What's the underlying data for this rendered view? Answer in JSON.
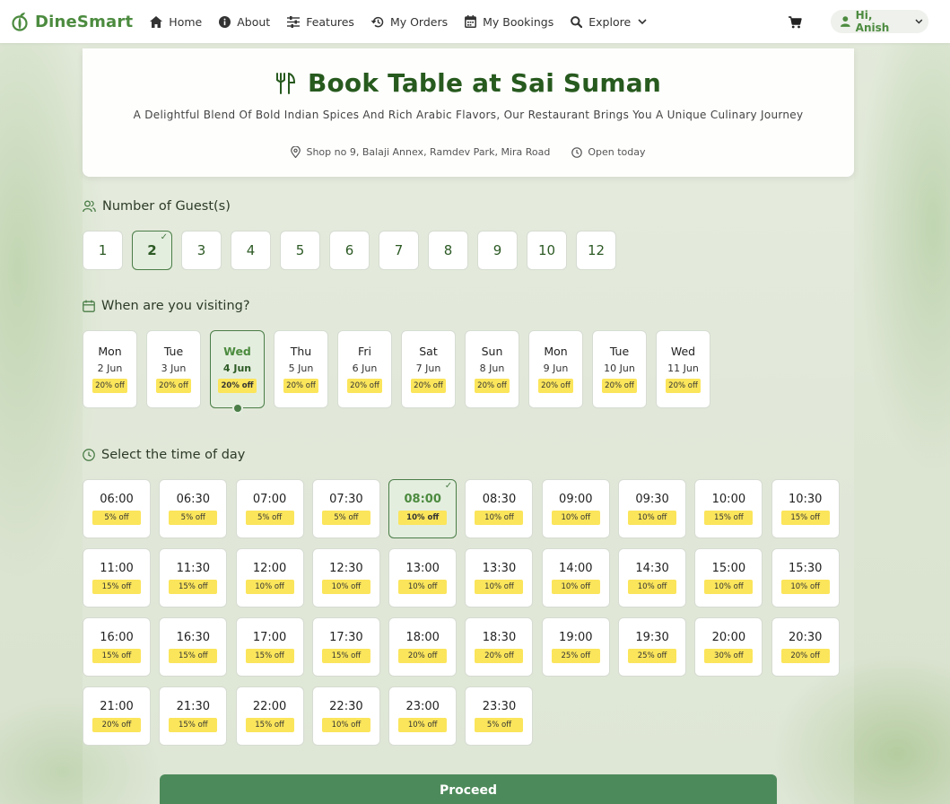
{
  "brand": {
    "name": "DineSmart"
  },
  "nav": {
    "items": [
      {
        "label": "Home",
        "icon": "home-icon"
      },
      {
        "label": "About",
        "icon": "info-icon"
      },
      {
        "label": "Features",
        "icon": "sliders-icon"
      },
      {
        "label": "My Orders",
        "icon": "history-icon"
      },
      {
        "label": "My Bookings",
        "icon": "calendar-icon"
      },
      {
        "label": "Explore",
        "icon": "search-icon"
      }
    ],
    "cart_icon": "cart-icon",
    "user_greeting": "Hi, Anish"
  },
  "header": {
    "title": "Book Table at Sai Suman",
    "subtitle": "A Delightful Blend Of Bold Indian Spices And Rich Arabic Flavors, Our Restaurant Brings You A Unique Culinary Journey",
    "address": "Shop no 9, Balaji Annex, Ramdev Park, Mira Road",
    "status": "Open today"
  },
  "guests": {
    "title": "Number of Guest(s)",
    "options": [
      "1",
      "2",
      "3",
      "4",
      "5",
      "6",
      "7",
      "8",
      "9",
      "10",
      "12"
    ],
    "selected": "2",
    "check_mark": "✓"
  },
  "visit": {
    "title": "When are you visiting?",
    "dates": [
      {
        "day": "Mon",
        "date": "2 Jun",
        "discount": "20% off"
      },
      {
        "day": "Tue",
        "date": "3 Jun",
        "discount": "20% off"
      },
      {
        "day": "Wed",
        "date": "4 Jun",
        "discount": "20% off"
      },
      {
        "day": "Thu",
        "date": "5 Jun",
        "discount": "20% off"
      },
      {
        "day": "Fri",
        "date": "6 Jun",
        "discount": "20% off"
      },
      {
        "day": "Sat",
        "date": "7 Jun",
        "discount": "20% off"
      },
      {
        "day": "Sun",
        "date": "8 Jun",
        "discount": "20% off"
      },
      {
        "day": "Mon",
        "date": "9 Jun",
        "discount": "20% off"
      },
      {
        "day": "Tue",
        "date": "10 Jun",
        "discount": "20% off"
      },
      {
        "day": "Wed",
        "date": "11 Jun",
        "discount": "20% off"
      }
    ],
    "selected_index": 2
  },
  "time": {
    "title": "Select the time of day",
    "slots": [
      {
        "time": "06:00",
        "discount": "5% off"
      },
      {
        "time": "06:30",
        "discount": "5% off"
      },
      {
        "time": "07:00",
        "discount": "5% off"
      },
      {
        "time": "07:30",
        "discount": "5% off"
      },
      {
        "time": "08:00",
        "discount": "10% off"
      },
      {
        "time": "08:30",
        "discount": "10% off"
      },
      {
        "time": "09:00",
        "discount": "10% off"
      },
      {
        "time": "09:30",
        "discount": "10% off"
      },
      {
        "time": "10:00",
        "discount": "15% off"
      },
      {
        "time": "10:30",
        "discount": "15% off"
      },
      {
        "time": "11:00",
        "discount": "15% off"
      },
      {
        "time": "11:30",
        "discount": "15% off"
      },
      {
        "time": "12:00",
        "discount": "10% off"
      },
      {
        "time": "12:30",
        "discount": "10% off"
      },
      {
        "time": "13:00",
        "discount": "10% off"
      },
      {
        "time": "13:30",
        "discount": "10% off"
      },
      {
        "time": "14:00",
        "discount": "10% off"
      },
      {
        "time": "14:30",
        "discount": "10% off"
      },
      {
        "time": "15:00",
        "discount": "10% off"
      },
      {
        "time": "15:30",
        "discount": "10% off"
      },
      {
        "time": "16:00",
        "discount": "15% off"
      },
      {
        "time": "16:30",
        "discount": "15% off"
      },
      {
        "time": "17:00",
        "discount": "15% off"
      },
      {
        "time": "17:30",
        "discount": "15% off"
      },
      {
        "time": "18:00",
        "discount": "20% off"
      },
      {
        "time": "18:30",
        "discount": "20% off"
      },
      {
        "time": "19:00",
        "discount": "25% off"
      },
      {
        "time": "19:30",
        "discount": "25% off"
      },
      {
        "time": "20:00",
        "discount": "30% off"
      },
      {
        "time": "20:30",
        "discount": "20% off"
      },
      {
        "time": "21:00",
        "discount": "20% off"
      },
      {
        "time": "21:30",
        "discount": "15% off"
      },
      {
        "time": "22:00",
        "discount": "15% off"
      },
      {
        "time": "22:30",
        "discount": "10% off"
      },
      {
        "time": "23:00",
        "discount": "10% off"
      },
      {
        "time": "23:30",
        "discount": "5% off"
      }
    ],
    "selected_index": 4
  },
  "proceed_label": "Proceed",
  "colors": {
    "brand_green": "#4c8b3f",
    "dark_green": "#275a1e",
    "selected_border": "#4a7d47",
    "selected_bg": "#e4eedf",
    "discount_badge": "#fbe55b",
    "proceed_button": "#4d8a5b"
  }
}
